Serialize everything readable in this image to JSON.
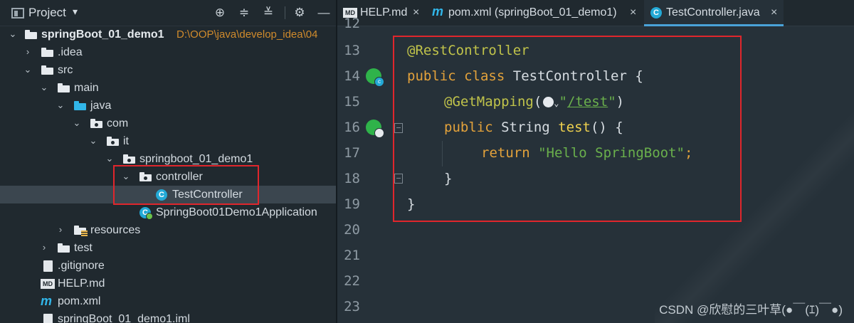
{
  "project_panel": {
    "title": "Project",
    "dropdown_glyph": "▾",
    "tools": [
      "target-icon",
      "expand-all-icon",
      "collapse-all-icon",
      "gear-icon",
      "minimize-icon"
    ],
    "tree": [
      {
        "label": "springBoot_01_demo1",
        "path": "D:\\OOP\\java\\develop_idea\\04",
        "icon": "module-folder-icon",
        "expanded": true
      },
      {
        "label": ".idea",
        "icon": "folder-icon",
        "expanded": false
      },
      {
        "label": "src",
        "icon": "folder-icon",
        "expanded": true
      },
      {
        "label": "main",
        "icon": "folder-icon",
        "expanded": true
      },
      {
        "label": "java",
        "icon": "source-folder-icon",
        "expanded": true
      },
      {
        "label": "com",
        "icon": "package-icon",
        "expanded": true
      },
      {
        "label": "it",
        "icon": "package-icon",
        "expanded": true
      },
      {
        "label": "springboot_01_demo1",
        "icon": "package-icon",
        "expanded": true
      },
      {
        "label": "controller",
        "icon": "package-icon",
        "expanded": true
      },
      {
        "label": "TestController",
        "icon": "class-icon",
        "selected": true
      },
      {
        "label": "SpringBoot01Demo1Application",
        "icon": "spring-boot-class-icon"
      },
      {
        "label": "resources",
        "icon": "resources-folder-icon",
        "expanded": false
      },
      {
        "label": "test",
        "icon": "folder-icon",
        "expanded": false
      },
      {
        "label": ".gitignore",
        "icon": "gitignore-file-icon"
      },
      {
        "label": "HELP.md",
        "icon": "markdown-file-icon"
      },
      {
        "label": "pom.xml",
        "icon": "maven-file-icon"
      },
      {
        "label": "springBoot_01_demo1.iml",
        "icon": "iml-file-icon"
      }
    ]
  },
  "editor": {
    "tabs": [
      {
        "label": "HELP.md",
        "icon": "markdown-file-icon",
        "close": "×",
        "active": false
      },
      {
        "label": "pom.xml (springBoot_01_demo1)",
        "icon": "maven-file-icon",
        "close": "×",
        "active": false
      },
      {
        "label": "TestController.java",
        "icon": "class-icon",
        "close": "×",
        "active": true
      }
    ],
    "line_numbers": [
      "12",
      "13",
      "14",
      "15",
      "16",
      "17",
      "18",
      "19",
      "20",
      "21",
      "22",
      "23"
    ],
    "code": {
      "l13": "@RestController",
      "l14_kw1": "public",
      "l14_kw2": "class",
      "l14_rest": "TestController {",
      "l15_ann": "@GetMapping",
      "l15_open": "(",
      "l15_chev": "⌄",
      "l15_q1": "\"",
      "l15_url": "/test",
      "l15_q2": "\"",
      "l15_close": ")",
      "l16_kw": "public",
      "l16_type": "String",
      "l16_fn": "test",
      "l16_rest": "() {",
      "l17_kw": "return",
      "l17_str": "\"Hello SpringBoot\"",
      "l17_semi": ";",
      "l18": "}",
      "l19": "}"
    }
  },
  "watermark": "CSDN @欣慰的三叶草(●￣(ｴ)￣●)",
  "colors": {
    "highlight_box": "#e0262c",
    "keyword": "#e3a23b",
    "annotation": "#c0c34a",
    "string": "#6ab04c"
  }
}
